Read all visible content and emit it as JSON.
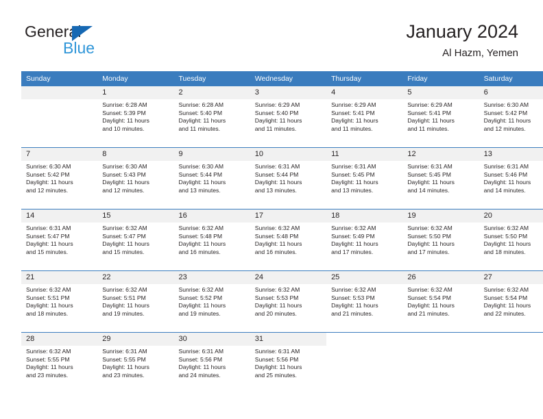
{
  "brand": {
    "name_line1": "General",
    "name_line2": "Blue",
    "triangle_color": "#1668b3",
    "blue_text_color": "#2e95d8"
  },
  "header": {
    "title": "January 2024",
    "location": "Al Hazm, Yemen"
  },
  "theme": {
    "header_row_bg": "#3a7cbe",
    "header_row_text": "#ffffff",
    "daynum_band_bg": "#f1f1f1",
    "week_separator": "#3a7cbe",
    "body_text": "#231f20"
  },
  "weekday_headers": [
    "Sunday",
    "Monday",
    "Tuesday",
    "Wednesday",
    "Thursday",
    "Friday",
    "Saturday"
  ],
  "weeks": [
    [
      {
        "day": "",
        "sunrise": "",
        "sunset": "",
        "daylight_line1": "",
        "daylight_line2": "",
        "empty": true
      },
      {
        "day": "1",
        "sunrise": "Sunrise: 6:28 AM",
        "sunset": "Sunset: 5:39 PM",
        "daylight_line1": "Daylight: 11 hours",
        "daylight_line2": "and 10 minutes."
      },
      {
        "day": "2",
        "sunrise": "Sunrise: 6:28 AM",
        "sunset": "Sunset: 5:40 PM",
        "daylight_line1": "Daylight: 11 hours",
        "daylight_line2": "and 11 minutes."
      },
      {
        "day": "3",
        "sunrise": "Sunrise: 6:29 AM",
        "sunset": "Sunset: 5:40 PM",
        "daylight_line1": "Daylight: 11 hours",
        "daylight_line2": "and 11 minutes."
      },
      {
        "day": "4",
        "sunrise": "Sunrise: 6:29 AM",
        "sunset": "Sunset: 5:41 PM",
        "daylight_line1": "Daylight: 11 hours",
        "daylight_line2": "and 11 minutes."
      },
      {
        "day": "5",
        "sunrise": "Sunrise: 6:29 AM",
        "sunset": "Sunset: 5:41 PM",
        "daylight_line1": "Daylight: 11 hours",
        "daylight_line2": "and 11 minutes."
      },
      {
        "day": "6",
        "sunrise": "Sunrise: 6:30 AM",
        "sunset": "Sunset: 5:42 PM",
        "daylight_line1": "Daylight: 11 hours",
        "daylight_line2": "and 12 minutes."
      }
    ],
    [
      {
        "day": "7",
        "sunrise": "Sunrise: 6:30 AM",
        "sunset": "Sunset: 5:42 PM",
        "daylight_line1": "Daylight: 11 hours",
        "daylight_line2": "and 12 minutes."
      },
      {
        "day": "8",
        "sunrise": "Sunrise: 6:30 AM",
        "sunset": "Sunset: 5:43 PM",
        "daylight_line1": "Daylight: 11 hours",
        "daylight_line2": "and 12 minutes."
      },
      {
        "day": "9",
        "sunrise": "Sunrise: 6:30 AM",
        "sunset": "Sunset: 5:44 PM",
        "daylight_line1": "Daylight: 11 hours",
        "daylight_line2": "and 13 minutes."
      },
      {
        "day": "10",
        "sunrise": "Sunrise: 6:31 AM",
        "sunset": "Sunset: 5:44 PM",
        "daylight_line1": "Daylight: 11 hours",
        "daylight_line2": "and 13 minutes."
      },
      {
        "day": "11",
        "sunrise": "Sunrise: 6:31 AM",
        "sunset": "Sunset: 5:45 PM",
        "daylight_line1": "Daylight: 11 hours",
        "daylight_line2": "and 13 minutes."
      },
      {
        "day": "12",
        "sunrise": "Sunrise: 6:31 AM",
        "sunset": "Sunset: 5:45 PM",
        "daylight_line1": "Daylight: 11 hours",
        "daylight_line2": "and 14 minutes."
      },
      {
        "day": "13",
        "sunrise": "Sunrise: 6:31 AM",
        "sunset": "Sunset: 5:46 PM",
        "daylight_line1": "Daylight: 11 hours",
        "daylight_line2": "and 14 minutes."
      }
    ],
    [
      {
        "day": "14",
        "sunrise": "Sunrise: 6:31 AM",
        "sunset": "Sunset: 5:47 PM",
        "daylight_line1": "Daylight: 11 hours",
        "daylight_line2": "and 15 minutes."
      },
      {
        "day": "15",
        "sunrise": "Sunrise: 6:32 AM",
        "sunset": "Sunset: 5:47 PM",
        "daylight_line1": "Daylight: 11 hours",
        "daylight_line2": "and 15 minutes."
      },
      {
        "day": "16",
        "sunrise": "Sunrise: 6:32 AM",
        "sunset": "Sunset: 5:48 PM",
        "daylight_line1": "Daylight: 11 hours",
        "daylight_line2": "and 16 minutes."
      },
      {
        "day": "17",
        "sunrise": "Sunrise: 6:32 AM",
        "sunset": "Sunset: 5:48 PM",
        "daylight_line1": "Daylight: 11 hours",
        "daylight_line2": "and 16 minutes."
      },
      {
        "day": "18",
        "sunrise": "Sunrise: 6:32 AM",
        "sunset": "Sunset: 5:49 PM",
        "daylight_line1": "Daylight: 11 hours",
        "daylight_line2": "and 17 minutes."
      },
      {
        "day": "19",
        "sunrise": "Sunrise: 6:32 AM",
        "sunset": "Sunset: 5:50 PM",
        "daylight_line1": "Daylight: 11 hours",
        "daylight_line2": "and 17 minutes."
      },
      {
        "day": "20",
        "sunrise": "Sunrise: 6:32 AM",
        "sunset": "Sunset: 5:50 PM",
        "daylight_line1": "Daylight: 11 hours",
        "daylight_line2": "and 18 minutes."
      }
    ],
    [
      {
        "day": "21",
        "sunrise": "Sunrise: 6:32 AM",
        "sunset": "Sunset: 5:51 PM",
        "daylight_line1": "Daylight: 11 hours",
        "daylight_line2": "and 18 minutes."
      },
      {
        "day": "22",
        "sunrise": "Sunrise: 6:32 AM",
        "sunset": "Sunset: 5:51 PM",
        "daylight_line1": "Daylight: 11 hours",
        "daylight_line2": "and 19 minutes."
      },
      {
        "day": "23",
        "sunrise": "Sunrise: 6:32 AM",
        "sunset": "Sunset: 5:52 PM",
        "daylight_line1": "Daylight: 11 hours",
        "daylight_line2": "and 19 minutes."
      },
      {
        "day": "24",
        "sunrise": "Sunrise: 6:32 AM",
        "sunset": "Sunset: 5:53 PM",
        "daylight_line1": "Daylight: 11 hours",
        "daylight_line2": "and 20 minutes."
      },
      {
        "day": "25",
        "sunrise": "Sunrise: 6:32 AM",
        "sunset": "Sunset: 5:53 PM",
        "daylight_line1": "Daylight: 11 hours",
        "daylight_line2": "and 21 minutes."
      },
      {
        "day": "26",
        "sunrise": "Sunrise: 6:32 AM",
        "sunset": "Sunset: 5:54 PM",
        "daylight_line1": "Daylight: 11 hours",
        "daylight_line2": "and 21 minutes."
      },
      {
        "day": "27",
        "sunrise": "Sunrise: 6:32 AM",
        "sunset": "Sunset: 5:54 PM",
        "daylight_line1": "Daylight: 11 hours",
        "daylight_line2": "and 22 minutes."
      }
    ],
    [
      {
        "day": "28",
        "sunrise": "Sunrise: 6:32 AM",
        "sunset": "Sunset: 5:55 PM",
        "daylight_line1": "Daylight: 11 hours",
        "daylight_line2": "and 23 minutes."
      },
      {
        "day": "29",
        "sunrise": "Sunrise: 6:31 AM",
        "sunset": "Sunset: 5:55 PM",
        "daylight_line1": "Daylight: 11 hours",
        "daylight_line2": "and 23 minutes."
      },
      {
        "day": "30",
        "sunrise": "Sunrise: 6:31 AM",
        "sunset": "Sunset: 5:56 PM",
        "daylight_line1": "Daylight: 11 hours",
        "daylight_line2": "and 24 minutes."
      },
      {
        "day": "31",
        "sunrise": "Sunrise: 6:31 AM",
        "sunset": "Sunset: 5:56 PM",
        "daylight_line1": "Daylight: 11 hours",
        "daylight_line2": "and 25 minutes."
      },
      {
        "day": "",
        "sunrise": "",
        "sunset": "",
        "daylight_line1": "",
        "daylight_line2": "",
        "empty": true,
        "blank": true
      },
      {
        "day": "",
        "sunrise": "",
        "sunset": "",
        "daylight_line1": "",
        "daylight_line2": "",
        "empty": true,
        "blank": true
      },
      {
        "day": "",
        "sunrise": "",
        "sunset": "",
        "daylight_line1": "",
        "daylight_line2": "",
        "empty": true,
        "blank": true
      }
    ]
  ]
}
